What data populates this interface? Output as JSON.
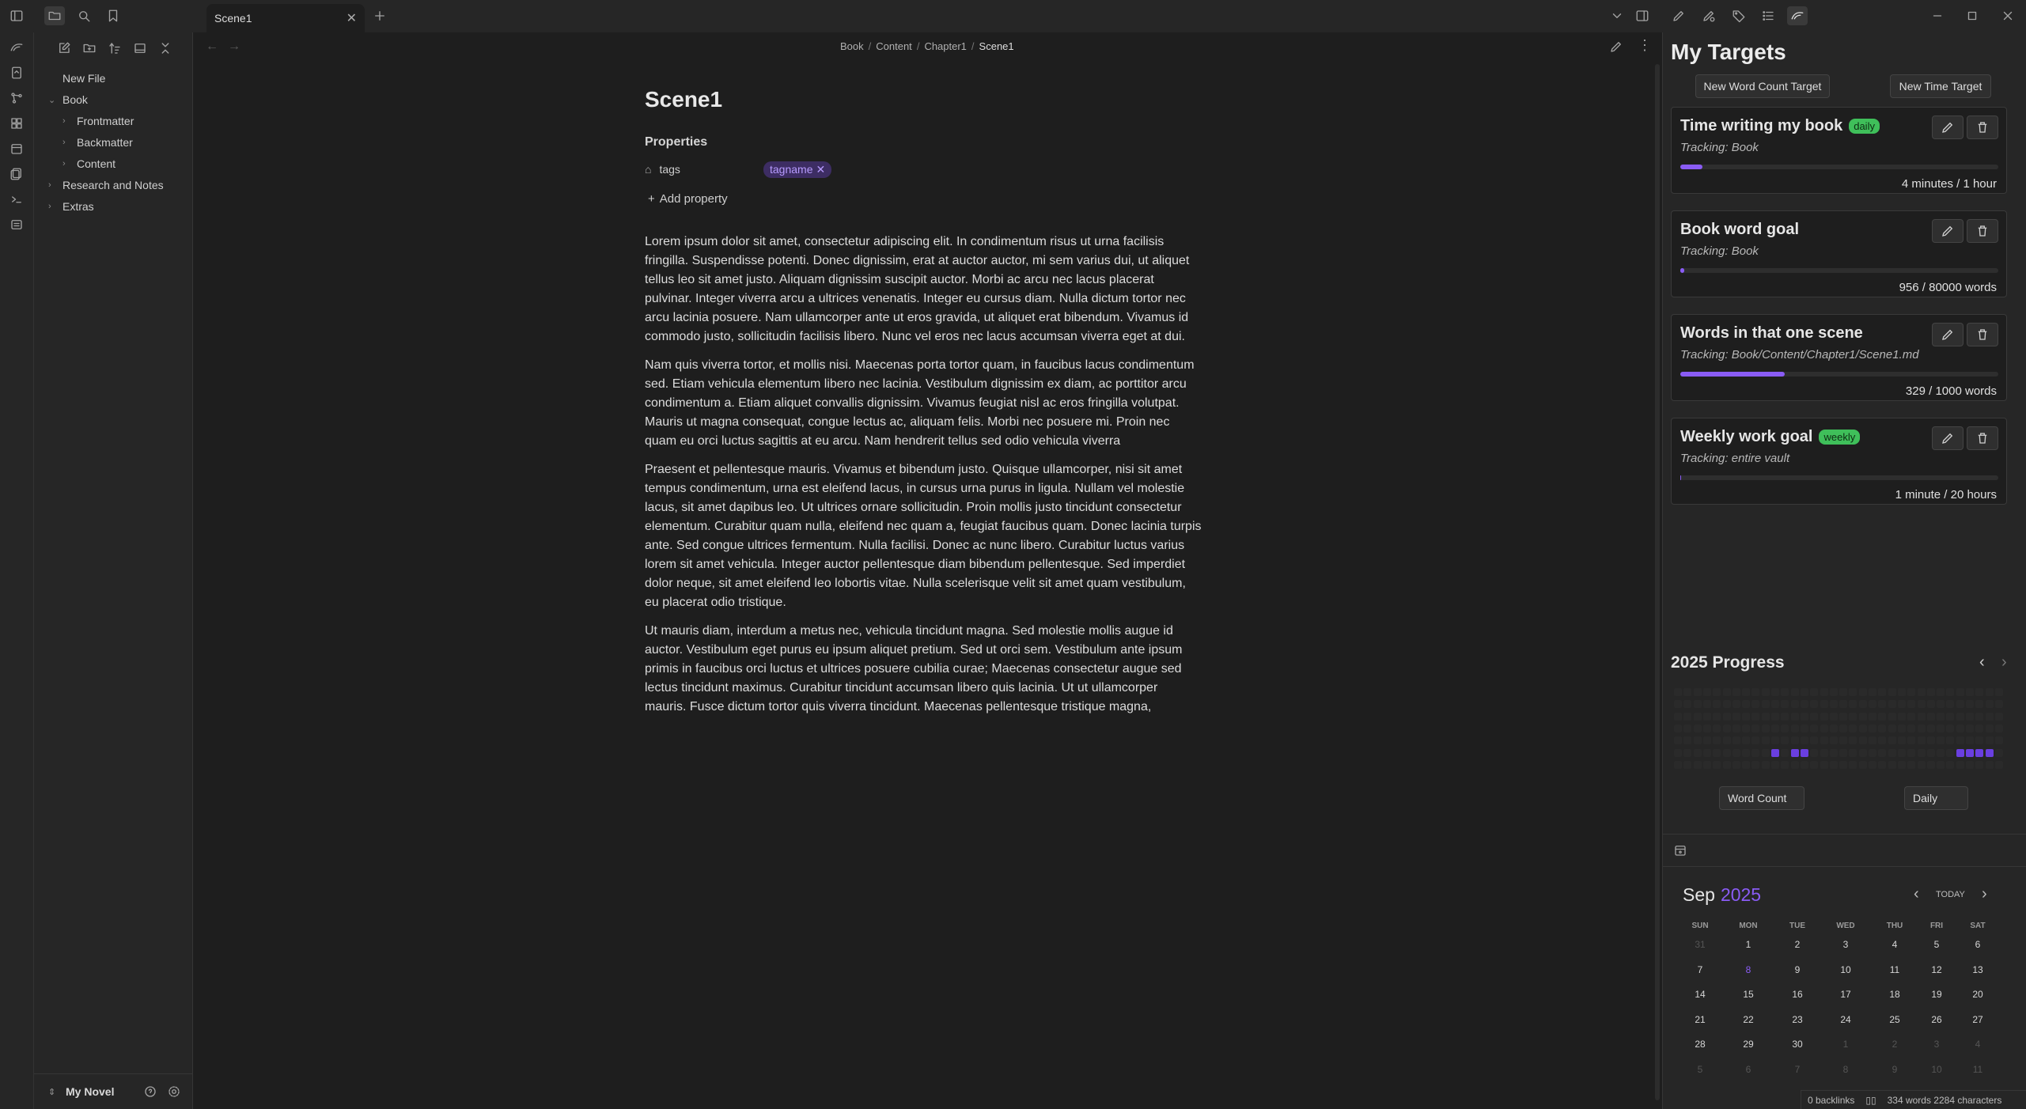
{
  "tab": {
    "title": "Scene1"
  },
  "sidebar": {
    "items": [
      {
        "label": "New File"
      },
      {
        "label": "Book"
      },
      {
        "label": "Frontmatter"
      },
      {
        "label": "Backmatter"
      },
      {
        "label": "Content"
      },
      {
        "label": "Research and Notes"
      },
      {
        "label": "Extras"
      }
    ],
    "vault": "My Novel"
  },
  "breadcrumb": [
    "Book",
    "Content",
    "Chapter1",
    "Scene1"
  ],
  "note": {
    "title": "Scene1",
    "properties_label": "Properties",
    "property_key": "tags",
    "tag": "tagname",
    "add_property": "Add property",
    "paragraphs": [
      "Lorem ipsum dolor sit amet, consectetur adipiscing elit. In condimentum risus ut urna facilisis fringilla. Suspendisse potenti. Donec dignissim, erat at auctor auctor, mi sem varius dui, ut aliquet tellus leo sit amet justo. Aliquam dignissim suscipit auctor. Morbi ac arcu nec lacus placerat pulvinar. Integer viverra arcu a ultrices venenatis. Integer eu cursus diam. Nulla dictum tortor nec arcu lacinia posuere. Nam ullamcorper ante ut eros gravida, ut aliquet erat bibendum. Vivamus id commodo justo, sollicitudin facilisis libero. Nunc vel eros nec lacus accumsan viverra eget at dui.",
      "Nam quis viverra tortor, et mollis nisi. Maecenas porta tortor quam, in faucibus lacus condimentum sed. Etiam vehicula elementum libero nec lacinia. Vestibulum dignissim ex diam, ac porttitor arcu condimentum a. Etiam aliquet convallis dignissim. Vivamus feugiat nisl ac eros fringilla volutpat. Mauris ut magna consequat, congue lectus ac, aliquam felis. Morbi nec posuere mi. Proin nec quam eu orci luctus sagittis at eu arcu. Nam hendrerit tellus sed odio vehicula viverra",
      "Praesent et pellentesque mauris. Vivamus et bibendum justo. Quisque ullamcorper, nisi sit amet tempus condimentum, urna est eleifend lacus, in cursus urna purus in ligula. Nullam vel molestie lacus, sit amet dapibus leo. Ut ultrices ornare sollicitudin. Proin mollis justo tincidunt consectetur elementum. Curabitur quam nulla, eleifend nec quam a, feugiat faucibus quam. Donec lacinia turpis ante. Sed congue ultrices fermentum. Nulla facilisi. Donec ac nunc libero. Curabitur luctus varius lorem sit amet vehicula. Integer auctor pellentesque diam bibendum pellentesque. Sed imperdiet dolor neque, sit amet eleifend leo lobortis vitae. Nulla scelerisque velit sit amet quam vestibulum, eu placerat odio tristique.",
      "Ut mauris diam, interdum a metus nec, vehicula tincidunt magna. Sed molestie mollis augue id auctor. Vestibulum eget purus eu ipsum aliquet pretium. Sed ut orci sem. Vestibulum ante ipsum primis in faucibus orci luctus et ultrices posuere cubilia curae; Maecenas consectetur augue sed lectus tincidunt maximus. Curabitur tincidunt accumsan libero quis lacinia. Ut ut ullamcorper mauris. Fusce dictum tortor quis viverra tincidunt. Maecenas pellentesque tristique magna,"
    ]
  },
  "targets": {
    "heading": "My Targets",
    "new_word_count": "New Word Count Target",
    "new_time": "New Time Target",
    "items": [
      {
        "title": "Time writing my book",
        "badge": "daily",
        "tracking": "Tracking: Book",
        "count": "4 minutes / 1 hour",
        "progress": 0.07
      },
      {
        "title": "Book word goal",
        "badge": "",
        "tracking": "Tracking: Book",
        "count": "956 / 80000 words",
        "progress": 0.012
      },
      {
        "title": "Words in that one scene",
        "badge": "",
        "tracking": "Tracking: Book/Content/Chapter1/Scene1.md",
        "count": "329 / 1000 words",
        "progress": 0.329
      },
      {
        "title": "Weekly work goal",
        "badge": "weekly",
        "tracking": "Tracking: entire vault",
        "count": "1 minute / 20 hours",
        "progress": 0.001
      }
    ],
    "accent": "#8a5cf5",
    "badge_color": "#3fbf5a"
  },
  "progress": {
    "heading": "2025 Progress",
    "metric": "Word Count",
    "period": "Daily"
  },
  "calendar": {
    "month": "Sep",
    "year": "2025",
    "today": "TODAY",
    "weekdays": [
      "SUN",
      "MON",
      "TUE",
      "WED",
      "THU",
      "FRI",
      "SAT"
    ],
    "weeks": [
      [
        "31",
        "1",
        "2",
        "3",
        "4",
        "5",
        "6"
      ],
      [
        "7",
        "8",
        "9",
        "10",
        "11",
        "12",
        "13"
      ],
      [
        "14",
        "15",
        "16",
        "17",
        "18",
        "19",
        "20"
      ],
      [
        "21",
        "22",
        "23",
        "24",
        "25",
        "26",
        "27"
      ],
      [
        "28",
        "29",
        "30",
        "1",
        "2",
        "3",
        "4"
      ],
      [
        "5",
        "6",
        "7",
        "8",
        "9",
        "10",
        "11"
      ]
    ]
  },
  "statusbar": {
    "backlinks": "0 backlinks",
    "counts": "334 words 2284 characters"
  }
}
